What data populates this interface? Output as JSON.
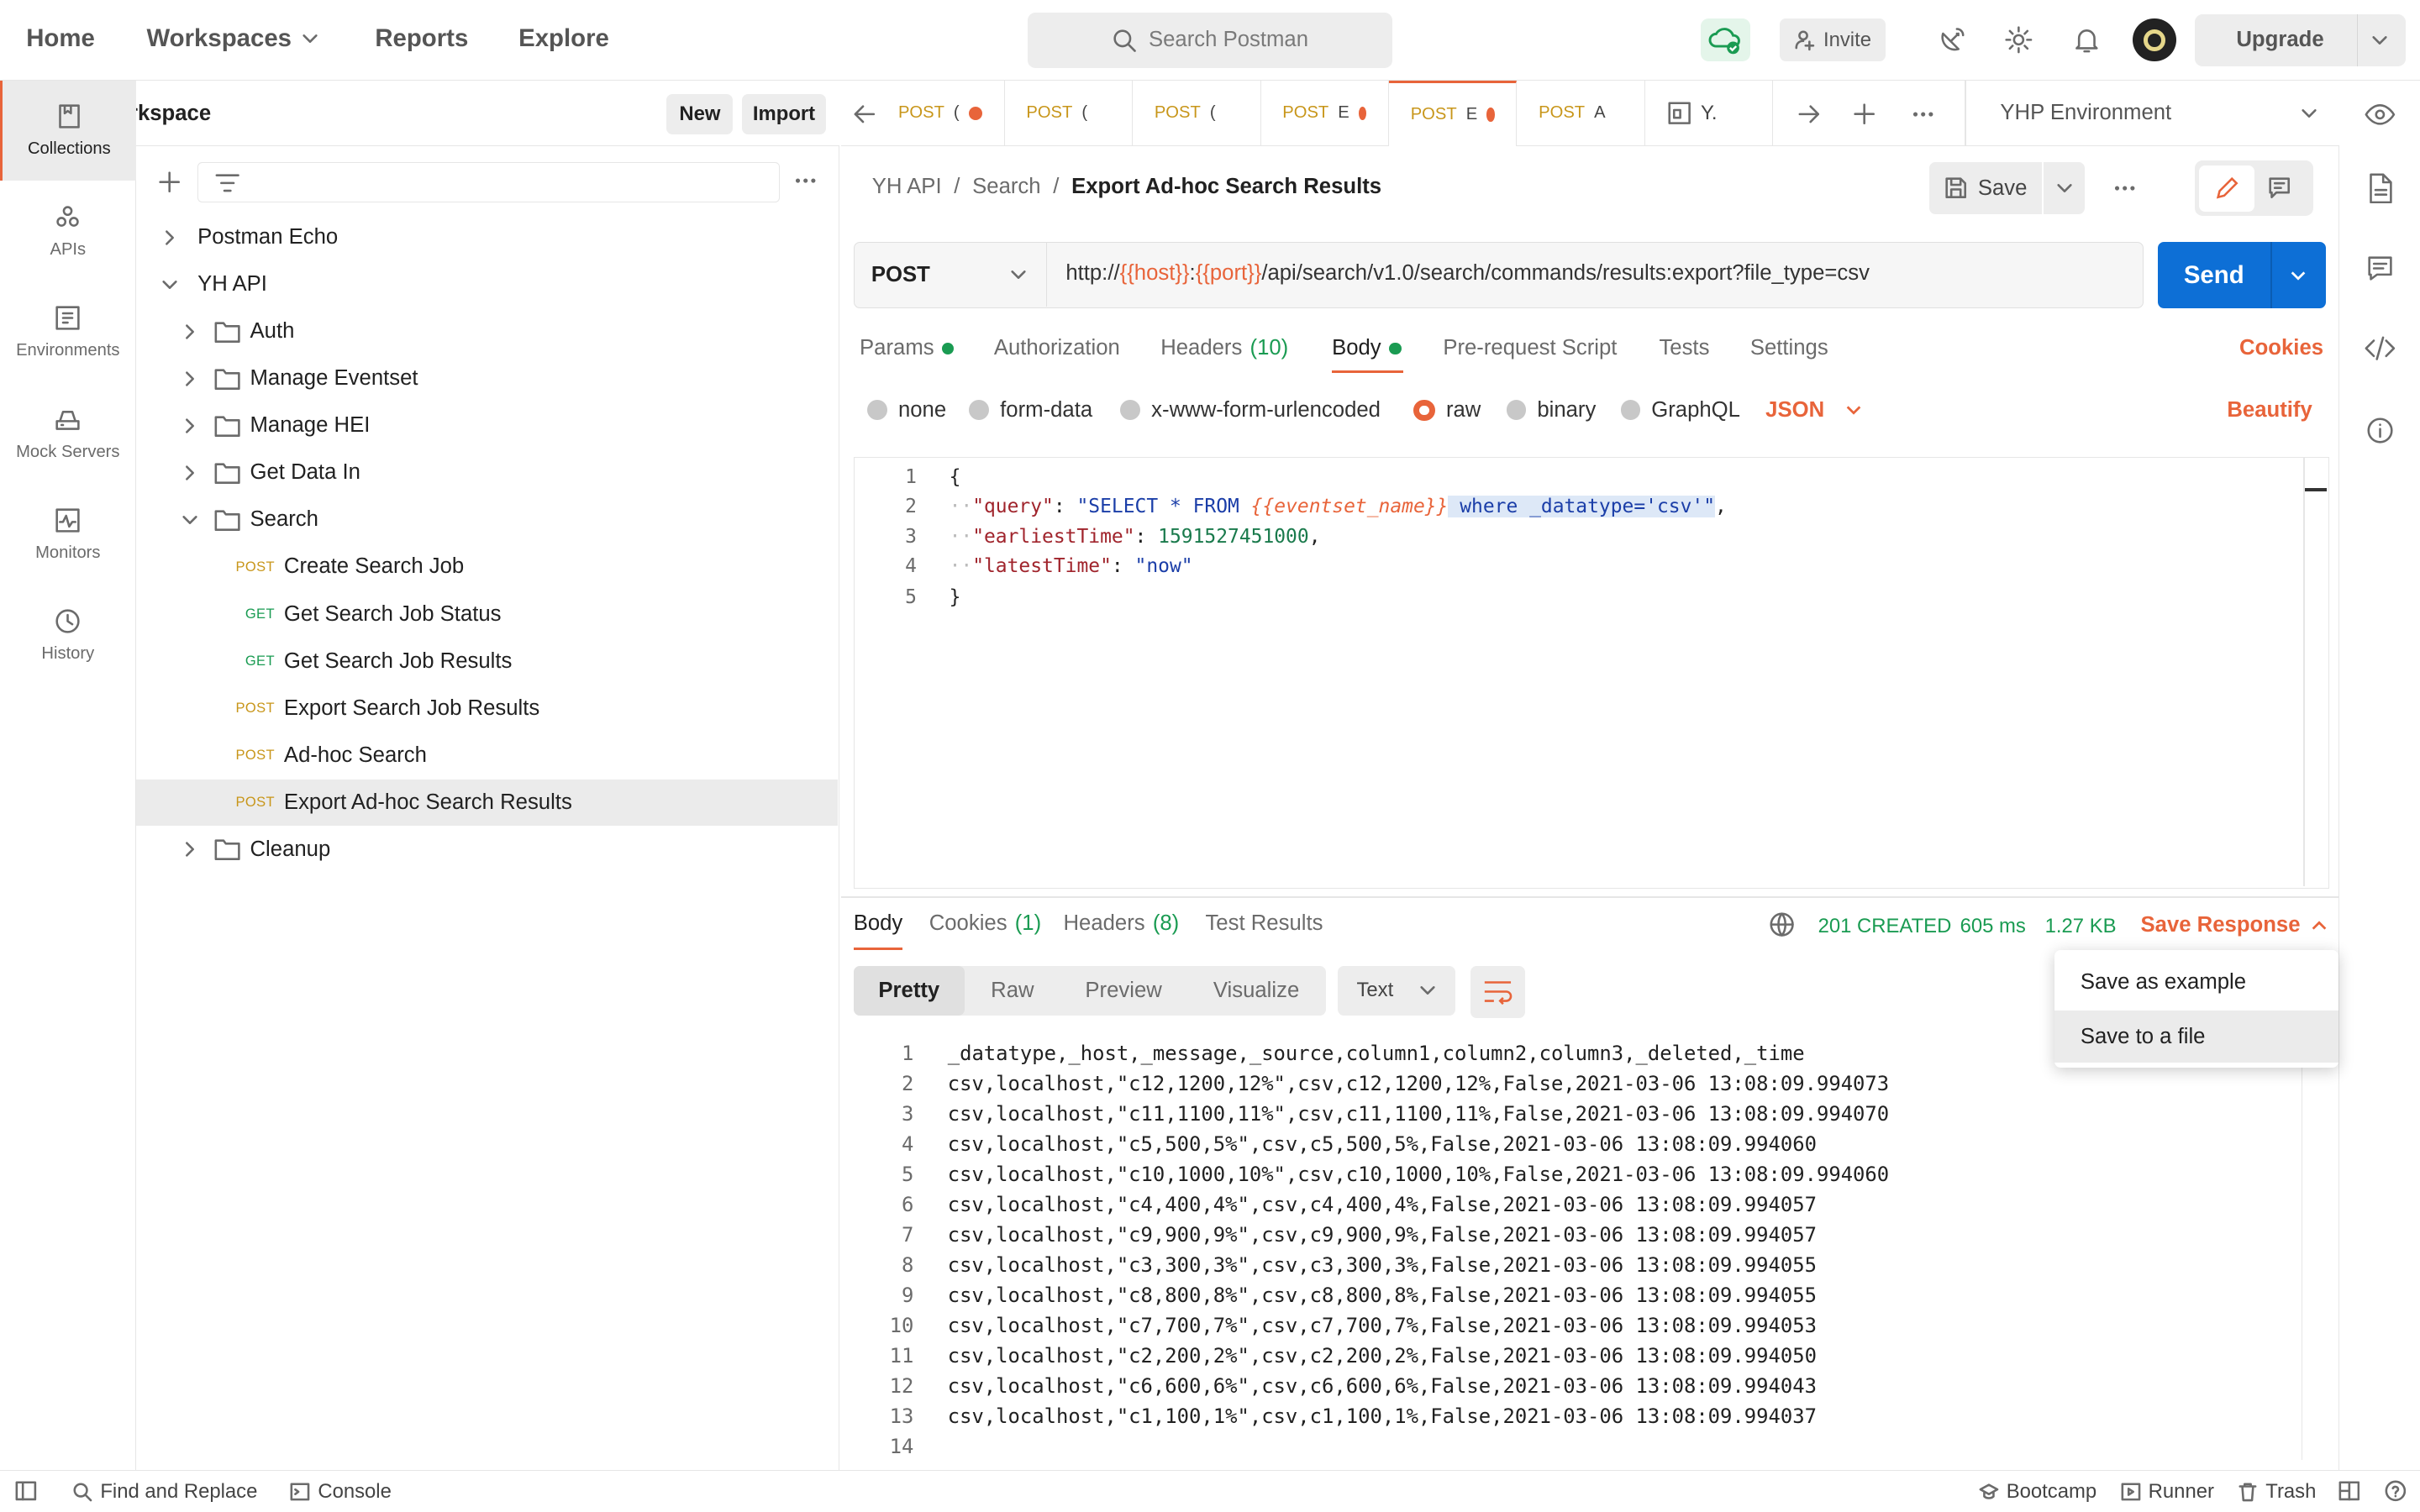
{
  "nav": {
    "home": "Home",
    "workspaces": "Workspaces",
    "reports": "Reports",
    "explore": "Explore",
    "search_placeholder": "Search Postman",
    "invite": "Invite",
    "upgrade": "Upgrade"
  },
  "workspace": {
    "title": "My Workspace",
    "new": "New",
    "import": "Import"
  },
  "rail": [
    {
      "label": "Collections",
      "icon": "collections-icon"
    },
    {
      "label": "APIs",
      "icon": "apis-icon"
    },
    {
      "label": "Environments",
      "icon": "environments-icon"
    },
    {
      "label": "Mock Servers",
      "icon": "mock-servers-icon"
    },
    {
      "label": "Monitors",
      "icon": "monitors-icon"
    },
    {
      "label": "History",
      "icon": "history-icon"
    }
  ],
  "tree": [
    {
      "label": "Postman Echo",
      "type": "collection",
      "chev": "right"
    },
    {
      "label": "YH API",
      "type": "collection",
      "chev": "down"
    },
    {
      "label": "Auth",
      "type": "folder",
      "chev": "right"
    },
    {
      "label": "Manage Eventset",
      "type": "folder",
      "chev": "right"
    },
    {
      "label": "Manage HEI",
      "type": "folder",
      "chev": "right"
    },
    {
      "label": "Get Data In",
      "type": "folder",
      "chev": "right"
    },
    {
      "label": "Search",
      "type": "folder",
      "chev": "down"
    },
    {
      "label": "Create Search Job",
      "type": "request",
      "method": "POST"
    },
    {
      "label": "Get Search Job Status",
      "type": "request",
      "method": "GET"
    },
    {
      "label": "Get Search Job Results",
      "type": "request",
      "method": "GET"
    },
    {
      "label": "Export Search Job Results",
      "type": "request",
      "method": "POST"
    },
    {
      "label": "Ad-hoc Search",
      "type": "request",
      "method": "POST"
    },
    {
      "label": "Export Ad-hoc Search Results",
      "type": "request",
      "method": "POST",
      "selected": true
    },
    {
      "label": "Cleanup",
      "type": "folder",
      "chev": "right"
    }
  ],
  "tabs": [
    {
      "method": "POST",
      "name": "(",
      "dot": true
    },
    {
      "method": "POST",
      "name": "(",
      "dot": false
    },
    {
      "method": "POST",
      "name": "(",
      "dot": false
    },
    {
      "method": "POST",
      "name": "E",
      "dot": true
    },
    {
      "method": "POST",
      "name": "E",
      "dot": true,
      "active": true
    },
    {
      "method": "POST",
      "name": "A",
      "dot": false
    },
    {
      "method": "",
      "name": "Y.",
      "dot": false
    }
  ],
  "environment": "YHP Environment",
  "breadcrumb": {
    "collection": "YH API",
    "folder": "Search",
    "request": "Export Ad-hoc Search Results",
    "sep": "/"
  },
  "save": "Save",
  "request": {
    "method": "POST",
    "url_prefix": "http://",
    "url_host": "{{host}}",
    "url_colon": ":",
    "url_port": "{{port}}",
    "url_path": "/api/search/v1.0/search/commands/results:export?file_type=csv",
    "send": "Send"
  },
  "req_tabs": {
    "params": "Params",
    "authorization": "Authorization",
    "headers": "Headers",
    "headers_count": "(10)",
    "body": "Body",
    "prerequest": "Pre-request Script",
    "tests": "Tests",
    "settings": "Settings",
    "cookies": "Cookies"
  },
  "body_types": {
    "none": "none",
    "form_data": "form-data",
    "urlencoded": "x-www-form-urlencoded",
    "raw": "raw",
    "binary": "binary",
    "graphql": "GraphQL",
    "format": "JSON",
    "beautify": "Beautify"
  },
  "body_code": {
    "l1": "{",
    "q_key": "\"query\"",
    "q_str1": "\"SELECT * FROM ",
    "q_var": "{{eventset_name}}",
    "q_str2": " where _datatype='csv'\"",
    "e_key": "\"earliestTime\"",
    "e_val": "1591527451000",
    "l_key": "\"latestTime\"",
    "l_val": "\"now\"",
    "l5": "}"
  },
  "resp_tabs": {
    "body": "Body",
    "cookies": "Cookies",
    "cookies_count": "(1)",
    "headers": "Headers",
    "headers_count": "(8)",
    "tests": "Test Results"
  },
  "resp_status": {
    "code": "201 CREATED",
    "time": "605 ms",
    "size": "1.27 KB",
    "save_response": "Save Response"
  },
  "resp_view": {
    "pretty": "Pretty",
    "raw": "Raw",
    "preview": "Preview",
    "visualize": "Visualize",
    "format": "Text"
  },
  "menu": {
    "example": "Save as example",
    "file": "Save to a file"
  },
  "response_lines": [
    "_datatype,_host,_message,_source,column1,column2,column3,_deleted,_time",
    "csv,localhost,\"c12,1200,12%\",csv,c12,1200,12%,False,2021-03-06 13:08:09.994073",
    "csv,localhost,\"c11,1100,11%\",csv,c11,1100,11%,False,2021-03-06 13:08:09.994070",
    "csv,localhost,\"c5,500,5%\",csv,c5,500,5%,False,2021-03-06 13:08:09.994060",
    "csv,localhost,\"c10,1000,10%\",csv,c10,1000,10%,False,2021-03-06 13:08:09.994060",
    "csv,localhost,\"c4,400,4%\",csv,c4,400,4%,False,2021-03-06 13:08:09.994057",
    "csv,localhost,\"c9,900,9%\",csv,c9,900,9%,False,2021-03-06 13:08:09.994057",
    "csv,localhost,\"c3,300,3%\",csv,c3,300,3%,False,2021-03-06 13:08:09.994055",
    "csv,localhost,\"c8,800,8%\",csv,c8,800,8%,False,2021-03-06 13:08:09.994055",
    "csv,localhost,\"c7,700,7%\",csv,c7,700,7%,False,2021-03-06 13:08:09.994053",
    "csv,localhost,\"c2,200,2%\",csv,c2,200,2%,False,2021-03-06 13:08:09.994050",
    "csv,localhost,\"c6,600,6%\",csv,c6,600,6%,False,2021-03-06 13:08:09.994043",
    "csv,localhost,\"c1,100,1%\",csv,c1,100,1%,False,2021-03-06 13:08:09.994037",
    ""
  ],
  "statusbar": {
    "find": "Find and Replace",
    "console": "Console",
    "bootcamp": "Bootcamp",
    "runner": "Runner",
    "trash": "Trash"
  },
  "colors": {
    "accent": "#e8643a",
    "send": "#0d6fd6",
    "success": "#1a9b52"
  }
}
